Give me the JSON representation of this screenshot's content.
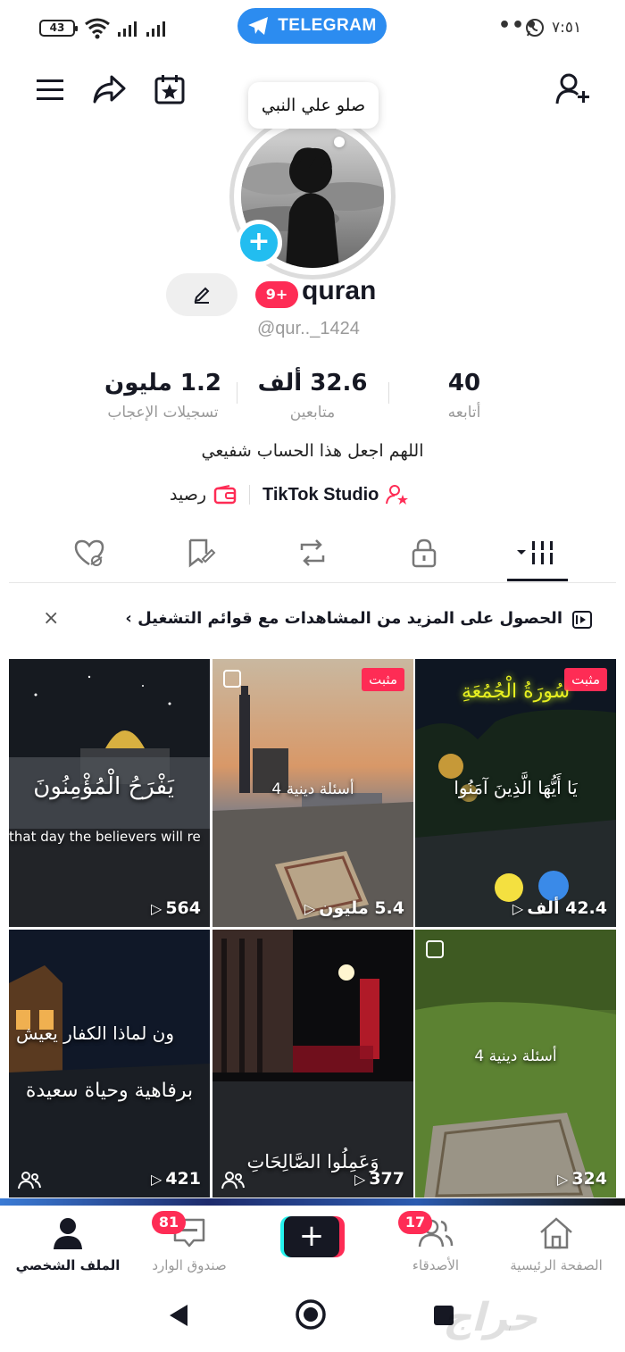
{
  "status_bar": {
    "battery": "43",
    "telegram_label": "TELEGRAM",
    "time": "٧:٥١",
    "dots": "•••"
  },
  "profile": {
    "note_bubble": "صلو علي النبي",
    "notification_badge": "9+",
    "username": "quran",
    "handle": "@qur.._1424",
    "stats": [
      {
        "value": "40",
        "label": "أتابعه"
      },
      {
        "value": "32.6  ألف",
        "label": "متابعين"
      },
      {
        "value": "1.2 مليون",
        "label": "تسجيلات الإعجاب"
      }
    ],
    "bio": "اللهم اجعل هذا الحساب شفيعي",
    "studio_label": "TikTok Studio",
    "balance_label": "رصيد"
  },
  "promo": {
    "text": "الحصول على المزيد من المشاهدات مع قوائم التشغيل ›",
    "close": "×"
  },
  "grid": {
    "pinned_label": "مثبت",
    "videos": [
      {
        "views": "42.4 ألف",
        "pinned": true,
        "caption_ar": "يَا أَيُّهَا الَّذِينَ آمَنُوا",
        "title_ar": "سُورَةُ الْجُمُعَةِ"
      },
      {
        "views": "5.4 مليون",
        "pinned": true,
        "caption_ar": "4 أسئلة دينية"
      },
      {
        "views": "564",
        "pinned": false,
        "caption_ar": "يَفْرَحُ الْمُؤْمِنُونَ",
        "caption_en": "that day the believers will re"
      },
      {
        "views": "324",
        "pinned": false,
        "caption_ar": "4 أسئلة دينية"
      },
      {
        "views": "377",
        "pinned": false,
        "caption_ar": "وَعَمِلُوا الصَّالِحَاتِ"
      },
      {
        "views": "421",
        "pinned": false,
        "caption_ar": "ون لماذا الكفار يعيش",
        "caption_ar2": "برفاهية وحياة سعيدة"
      }
    ]
  },
  "bottom_nav": {
    "home": "الصفحة الرئيسية",
    "friends": "الأصدقاء",
    "friends_badge": "17",
    "create": "+",
    "inbox": "صندوق الوارد",
    "inbox_badge": "81",
    "profile": "الملف الشخصي"
  },
  "watermark": "حراج",
  "colors": {
    "accent": "#fe2c55",
    "telegram": "#2c8cf0",
    "cyan": "#25f4ee",
    "text": "#161823"
  }
}
